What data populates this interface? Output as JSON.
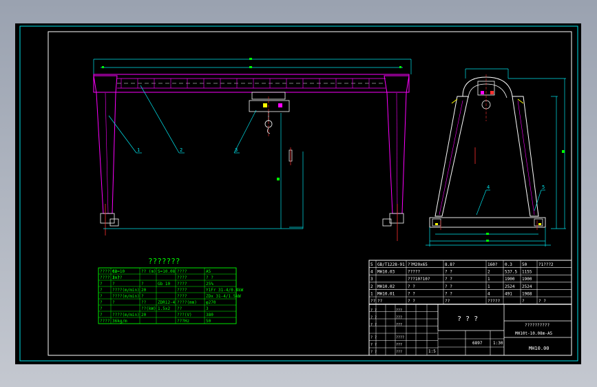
{
  "colors": {
    "background": "#000000",
    "frame": "#00e5ee",
    "border": "#ffffff",
    "magenta": "#ff00ff",
    "green": "#00ff00",
    "red": "#ff3030",
    "yellow": "#ffff00",
    "table": "#ffffff",
    "title": "#00ff00"
  },
  "labels": {
    "leader1": "1",
    "leader2": "2",
    "leader3": "3",
    "leader4": "4",
    "leader5": "5"
  },
  "param_table": {
    "title": "???????",
    "rows": [
      [
        "???? t2",
        "Gn=10",
        "?? (m)",
        "S=10.08",
        "????",
        "A5"
      ],
      [
        "???? (m)",
        "3 ??",
        "",
        "",
        "????",
        "? ?"
      ],
      [
        "?",
        "?",
        "?",
        "Gb 10",
        "????",
        "25%"
      ],
      [
        "?",
        "????(m/min)",
        "20",
        "",
        "????",
        "Y1Fr 31-4/0.4kW"
      ],
      [
        "?",
        "????(m/min)",
        "?",
        "",
        "????",
        "ZDx 31-4/1.5kW"
      ],
      [
        "?",
        "?",
        "??",
        "ZDR12-4",
        "????(mm)",
        "φ270"
      ],
      [
        "?",
        "",
        "??(kW)",
        "1.5x2",
        "??",
        "3"
      ],
      [
        "?",
        "????(m/min)",
        "20",
        "",
        "???(V)",
        "380"
      ],
      [
        "????",
        "36kg/m",
        "",
        "",
        "???Hz",
        "50"
      ]
    ]
  },
  "bom_table": {
    "rows": [
      [
        "5",
        "GB/T1228-91",
        "??M20x65",
        "8.8?",
        "160?",
        "0.3",
        "50",
        "?1???2"
      ],
      [
        "4",
        "MH10.03",
        "?????",
        "? ?",
        "2",
        "537.5",
        "1155",
        ""
      ],
      [
        "3",
        "",
        "???10?10?",
        "? ?",
        "1",
        "1900",
        "1900",
        ""
      ],
      [
        "2",
        "MH10.02",
        "? ?",
        "? ?",
        "1",
        "2524",
        "2524",
        ""
      ],
      [
        "1",
        "MH10.01",
        "? ?",
        "? ?",
        "4",
        "491",
        "1968",
        ""
      ],
      [
        "??",
        "??",
        "? ?",
        "??",
        "?????",
        "",
        "?",
        "? ?"
      ]
    ]
  },
  "title_block": {
    "big_title": "? ? ?",
    "company": "??????????",
    "drawing_no_label": "MH10t-10.08m-A5",
    "drawing_no": "MH10.00",
    "weight": "6897",
    "scale": "1:30",
    "sheet_left": "1:5",
    "sign_rows": [
      "? ?",
      "? ?",
      "? ?",
      "? ?",
      "? ?",
      "? ?"
    ],
    "sign_mid": [
      "???",
      "???",
      "???",
      "????",
      "???",
      "???"
    ]
  }
}
